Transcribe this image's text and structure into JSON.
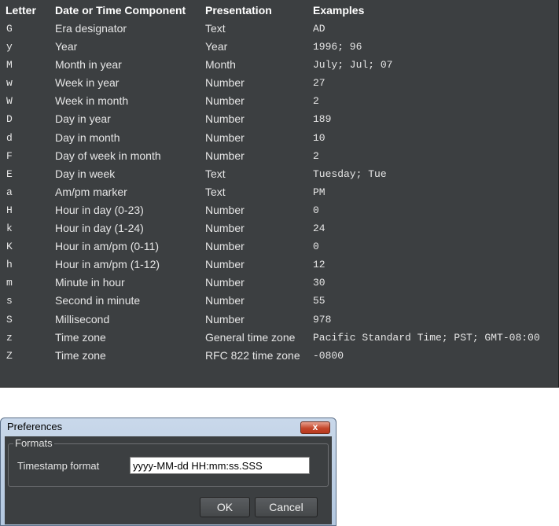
{
  "table": {
    "headers": [
      "Letter",
      "Date or Time Component",
      "Presentation",
      "Examples"
    ],
    "rows": [
      [
        "G",
        "Era designator",
        "Text",
        "AD"
      ],
      [
        "y",
        "Year",
        "Year",
        "1996; 96"
      ],
      [
        "M",
        "Month in year",
        "Month",
        "July; Jul; 07"
      ],
      [
        "w",
        "Week in year",
        "Number",
        "27"
      ],
      [
        "W",
        "Week in month",
        "Number",
        "2"
      ],
      [
        "D",
        "Day in year",
        "Number",
        "189"
      ],
      [
        "d",
        "Day in month",
        "Number",
        "10"
      ],
      [
        "F",
        "Day of week in month",
        "Number",
        "2"
      ],
      [
        "E",
        "Day in week",
        "Text",
        "Tuesday; Tue"
      ],
      [
        "a",
        "Am/pm marker",
        "Text",
        "PM"
      ],
      [
        "H",
        "Hour in day (0-23)",
        "Number",
        "0"
      ],
      [
        "k",
        "Hour in day (1-24)",
        "Number",
        "24"
      ],
      [
        "K",
        "Hour in am/pm (0-11)",
        "Number",
        "0"
      ],
      [
        "h",
        "Hour in am/pm (1-12)",
        "Number",
        "12"
      ],
      [
        "m",
        "Minute in hour",
        "Number",
        "30"
      ],
      [
        "s",
        "Second in minute",
        "Number",
        "55"
      ],
      [
        "S",
        "Millisecond",
        "Number",
        "978"
      ],
      [
        "z",
        "Time zone",
        "General time zone",
        "Pacific Standard Time; PST; GMT-08:00"
      ],
      [
        "Z",
        "Time zone",
        "RFC 822 time zone",
        "-0800"
      ]
    ]
  },
  "dialog": {
    "title": "Preferences",
    "close_label": "x",
    "group_label": "Formats",
    "timestamp_label": "Timestamp format",
    "timestamp_value": "yyyy-MM-dd HH:mm:ss.SSS",
    "ok_label": "OK",
    "cancel_label": "Cancel"
  }
}
